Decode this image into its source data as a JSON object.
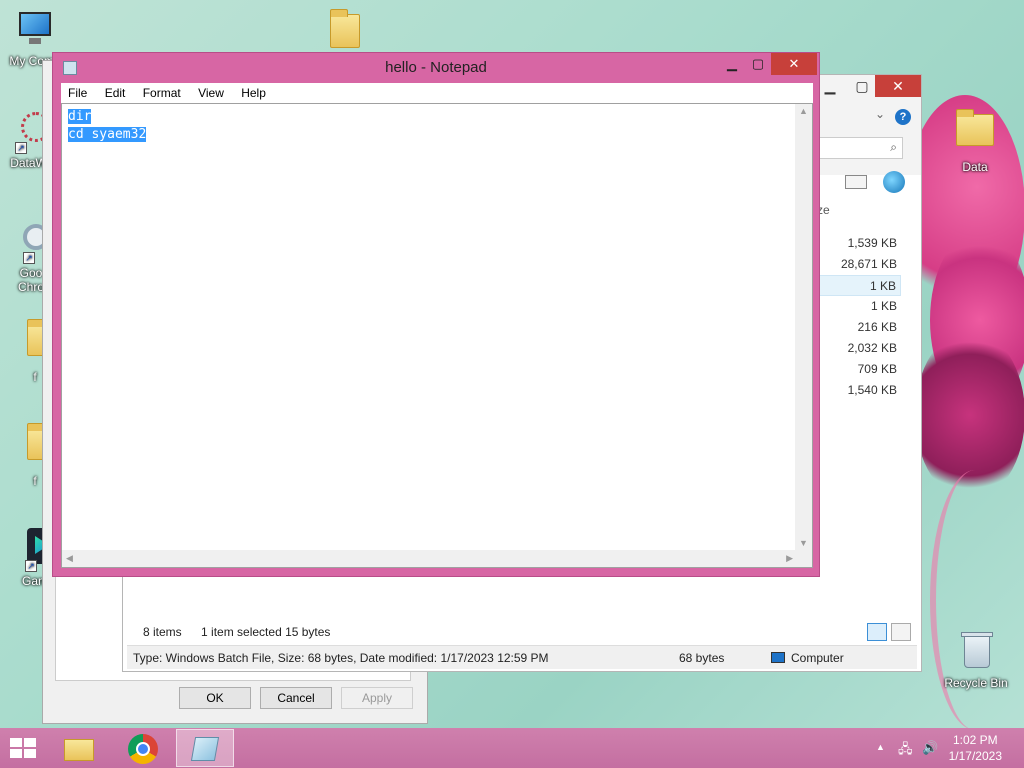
{
  "desktop": {
    "icons": [
      {
        "label": "My Comp"
      },
      {
        "label": "DataWag"
      },
      {
        "label": "Goo\nChro"
      },
      {
        "label": "f"
      },
      {
        "label": "f"
      },
      {
        "label": "Gam"
      },
      {
        "label": "Data"
      },
      {
        "label": "Recycle Bin"
      }
    ]
  },
  "properties": {
    "ok_label": "OK",
    "cancel_label": "Cancel",
    "apply_label": "Apply"
  },
  "explorer": {
    "size_header": "ze",
    "sizes": [
      "1,539 KB",
      "28,671 KB",
      "1 KB",
      "1 KB",
      "216 KB",
      "2,032 KB",
      "709 KB",
      "1,540 KB"
    ],
    "status_items": "8 items",
    "status_selected": "1 item selected  15 bytes",
    "details_text": "Type: Windows Batch File, Size: 68 bytes, Date modified: 1/17/2023 12:59 PM",
    "details_size": "68 bytes",
    "details_location": "Computer"
  },
  "notepad": {
    "title": "hello - Notepad",
    "menu": [
      "File",
      "Edit",
      "Format",
      "View",
      "Help"
    ],
    "lines": [
      "dir",
      "cd syaem32"
    ]
  },
  "taskbar": {
    "time": "1:02 PM",
    "date": "1/17/2023"
  },
  "colors": {
    "notepad_frame": "#d766a4",
    "selection": "#3399ff",
    "close_button": "#c7403a",
    "taskbar": "#c46fa1"
  }
}
